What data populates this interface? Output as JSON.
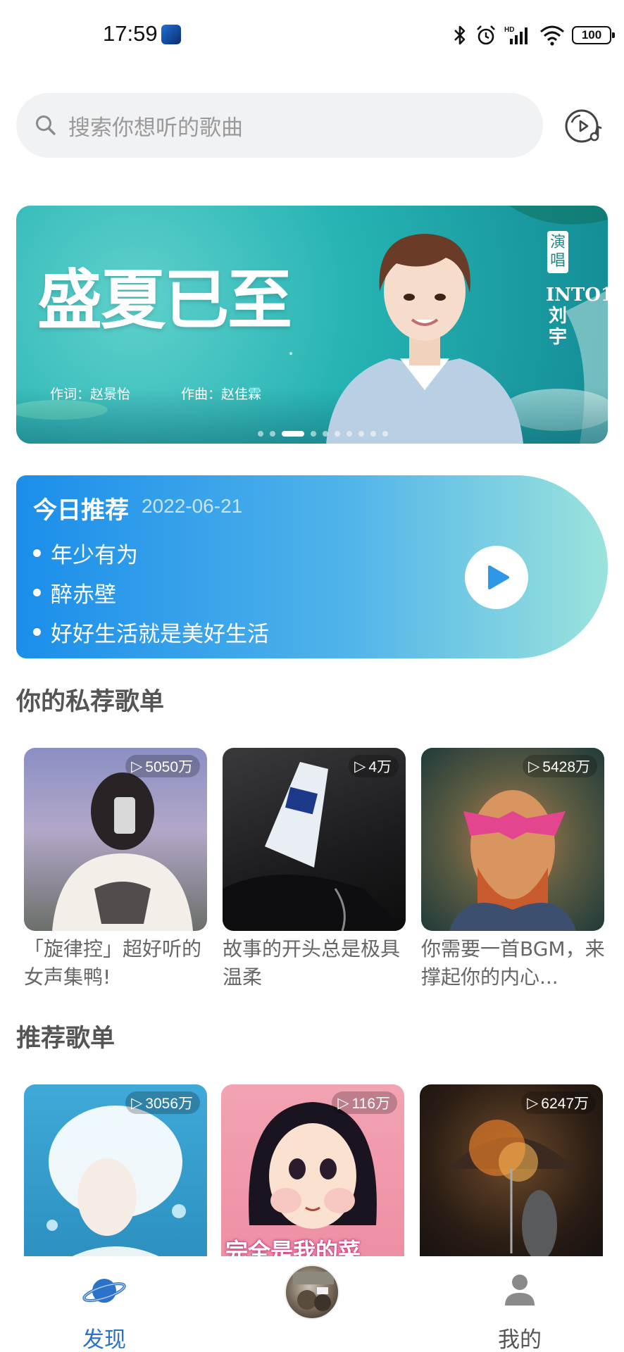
{
  "status_bar": {
    "time": "17:59",
    "battery": "100"
  },
  "search": {
    "placeholder": "搜索你想听的歌曲"
  },
  "banner": {
    "title": "盛夏已至",
    "lyricist": "作词：赵景怡",
    "composer": "作曲：赵佳霖",
    "singer_tag": "演唱",
    "singer": "INTO1 刘宇",
    "dot_count": 10,
    "active_dot": 2
  },
  "daily": {
    "title": "今日推荐",
    "date": "2022-06-21",
    "songs": [
      "年少有为",
      "醉赤壁",
      "好好生活就是美好生活"
    ]
  },
  "private_section": {
    "title": "你的私荐歌单",
    "items": [
      {
        "count": "5050万",
        "title": "「旋律控」超好听的女声集鸭!"
      },
      {
        "count": "4万",
        "title": "故事的开头总是极具温柔"
      },
      {
        "count": "5428万",
        "title": "你需要一首BGM，来撑起你的内心..."
      }
    ]
  },
  "recommend_section": {
    "title": "推荐歌单",
    "items": [
      {
        "count": "3056万"
      },
      {
        "count": "116万",
        "overlay": "完全是我的菜"
      },
      {
        "count": "6247万"
      }
    ]
  },
  "nav": {
    "discover": "发现",
    "mine": "我的",
    "active_color": "#2b72c8",
    "inactive_color": "#555555"
  }
}
